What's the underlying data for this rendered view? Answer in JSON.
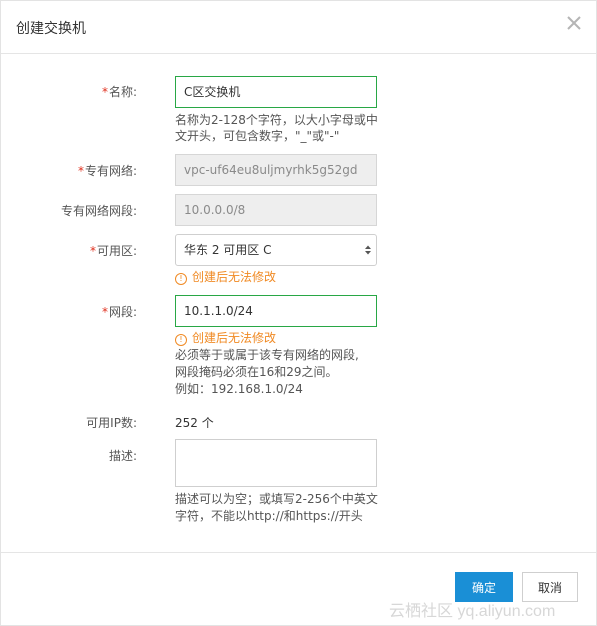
{
  "dialog": {
    "title": "创建交换机"
  },
  "form": {
    "name": {
      "required_mark": "*",
      "label": "名称:",
      "value": "C区交换机",
      "hint_line1": "名称为2-128个字符，以大小字母或中",
      "hint_line2": "文开头，可包含数字，\"_\"或\"-\""
    },
    "vpc": {
      "required_mark": "*",
      "label": "专有网络:",
      "value": "vpc-uf64eu8uljmyrhk5g52gd"
    },
    "vpc_cidr": {
      "label": "专有网络网段:",
      "value": "10.0.0.0/8"
    },
    "zone": {
      "required_mark": "*",
      "label": "可用区:",
      "selected": "华东 2 可用区 C",
      "warning": "创建后无法修改"
    },
    "cidr": {
      "required_mark": "*",
      "label": "网段:",
      "value": "10.1.1.0/24",
      "warning": "创建后无法修改",
      "hint_line1": "必须等于或属于该专有网络的网段,",
      "hint_line2": "网段掩码必须在16和29之间。",
      "hint_line3": "例如：192.168.1.0/24"
    },
    "available_ips": {
      "label": "可用IP数:",
      "value": "252 个"
    },
    "description": {
      "label": "描述:",
      "value": "",
      "hint_line1": "描述可以为空；或填写2-256个中英文",
      "hint_line2": "字符，不能以http://和https://开头"
    }
  },
  "buttons": {
    "confirm": "确定",
    "cancel": "取消"
  },
  "watermark": "云栖社区 yq.aliyun.com",
  "icons": {
    "close": "close-icon",
    "select_arrow": "updown-arrow-icon",
    "warning": "info-circle-icon"
  },
  "colors": {
    "primary": "#1a8fd6",
    "focus_border": "#28a745",
    "warning": "#f08a24",
    "required": "#e0301e"
  }
}
